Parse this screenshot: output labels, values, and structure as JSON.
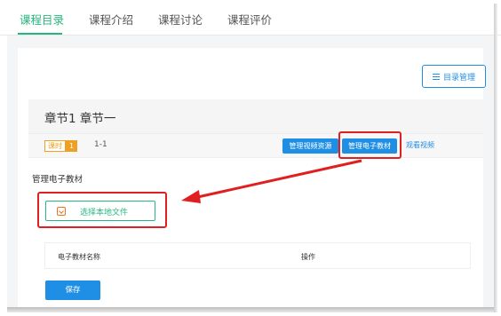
{
  "tabs": [
    {
      "label": "课程目录",
      "active": true
    },
    {
      "label": "课程介绍",
      "active": false
    },
    {
      "label": "课程讨论",
      "active": false
    },
    {
      "label": "课程评价",
      "active": false
    }
  ],
  "toolbar": {
    "catalog_manage_label": "目录管理",
    "catalog_icon": "list-icon"
  },
  "chapter": {
    "title": "章节1 章节一",
    "lesson": {
      "badge_label": "课时",
      "badge_count": "1",
      "name": "1-1",
      "manage_video_label": "管理视频资源",
      "manage_ebook_label": "管理电子教材",
      "view_video_label": "观看视频"
    }
  },
  "ebook_section": {
    "title": "管理电子教材",
    "choose_file_label": "选择本地文件",
    "file_icon": "upload-icon",
    "table_headers": [
      "电子教材名称",
      "操作"
    ],
    "save_label": "保存"
  },
  "colors": {
    "accent_green": "#26b77e",
    "accent_blue": "#1f8fe6",
    "highlight_red": "#e02020",
    "badge_orange": "#f0a020"
  }
}
